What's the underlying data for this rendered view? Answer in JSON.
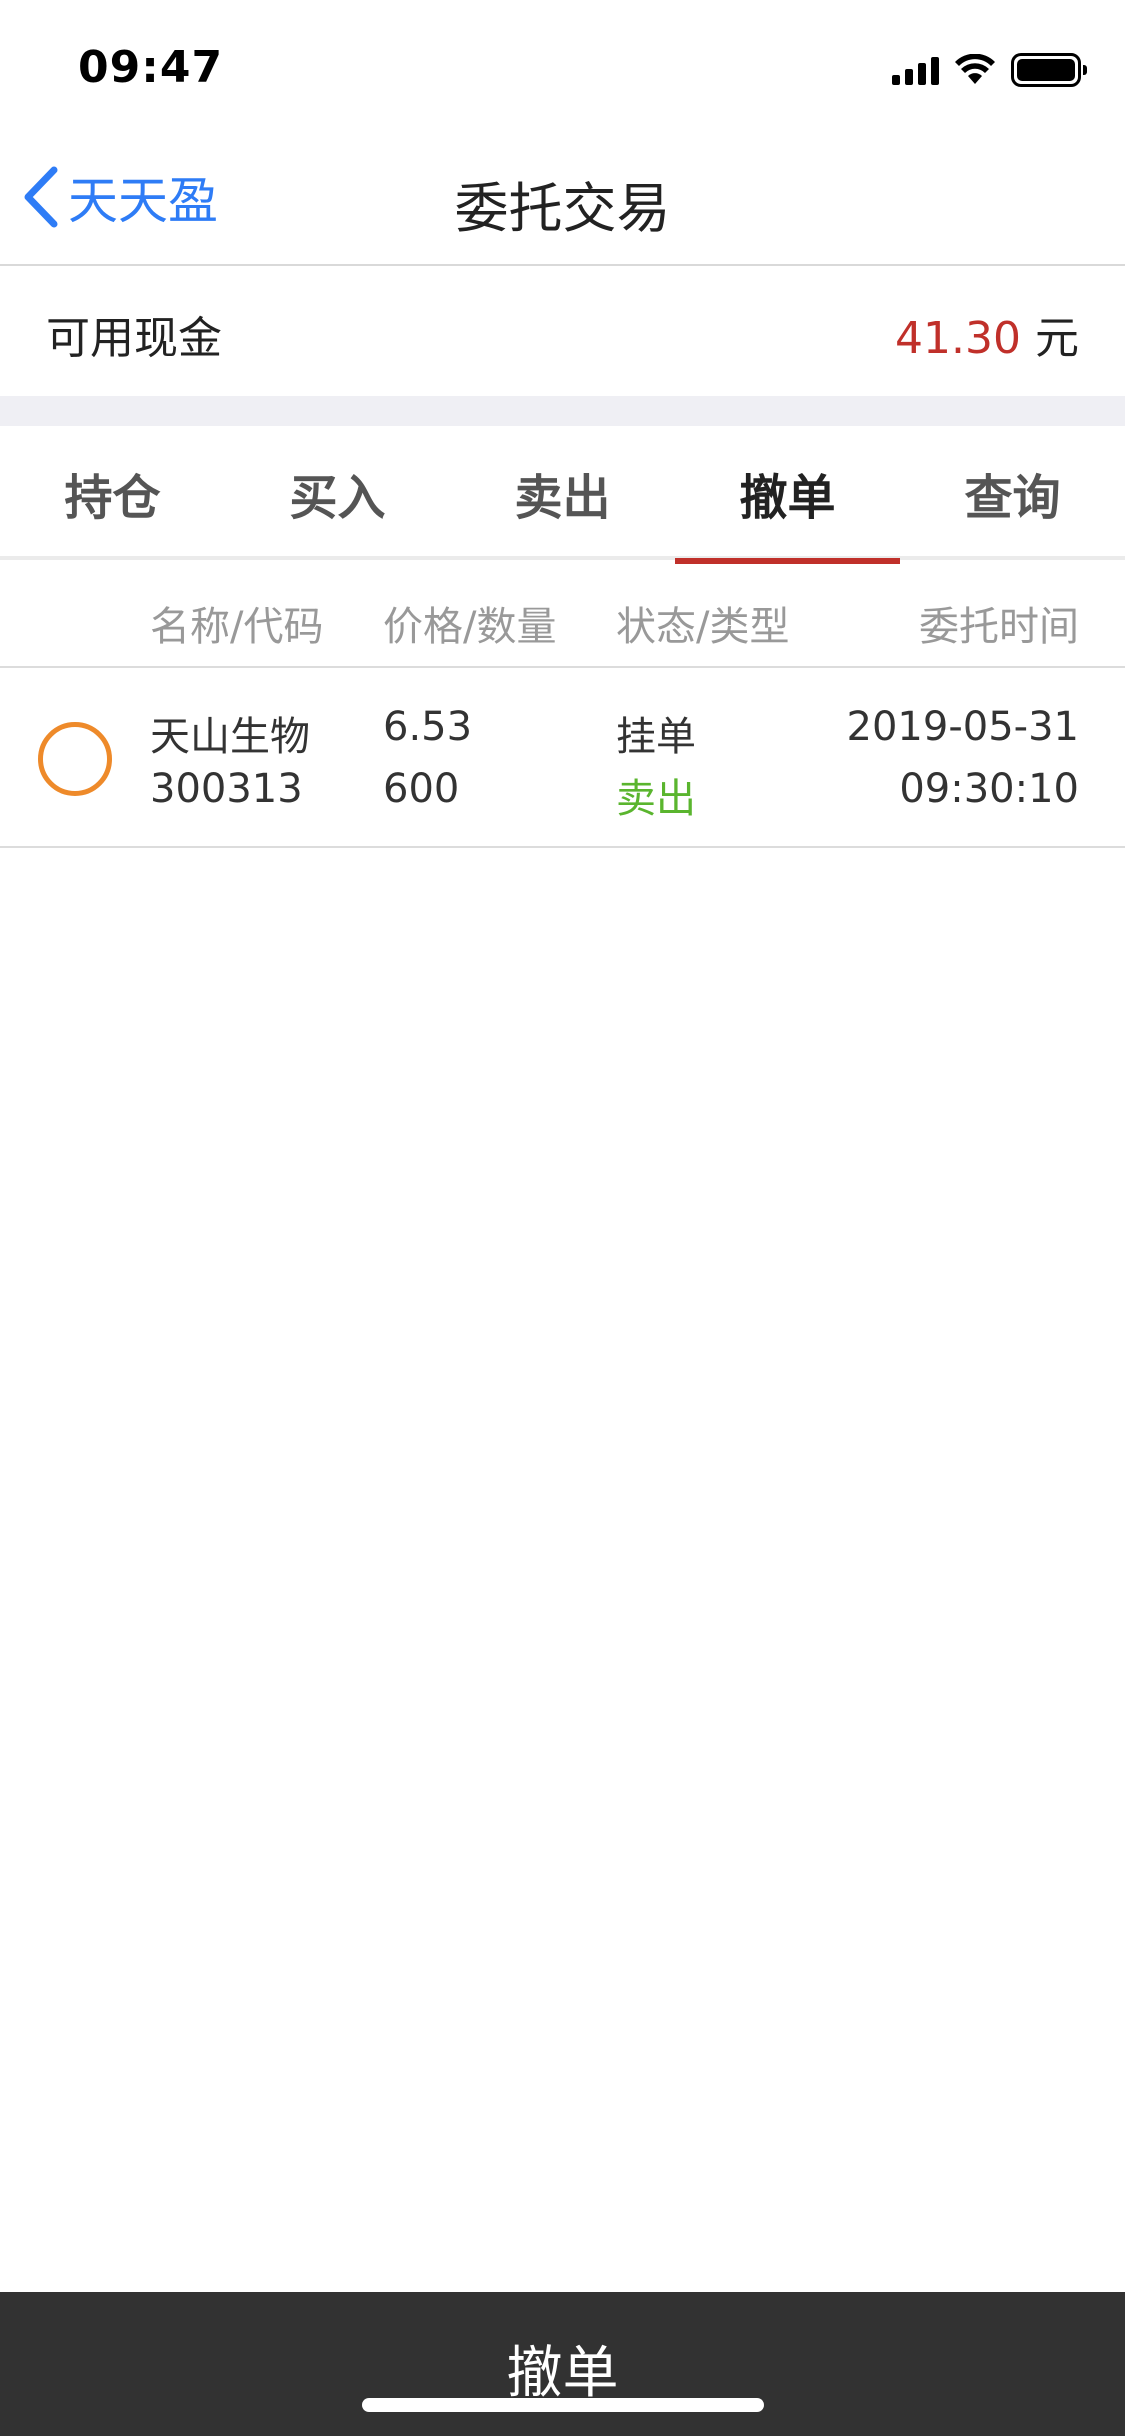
{
  "status_bar": {
    "time": "09:47"
  },
  "nav": {
    "back_label": "天天盈",
    "title": "委托交易"
  },
  "cash": {
    "label": "可用现金",
    "amount": "41.30",
    "unit": "元"
  },
  "tabs": [
    {
      "label": "持仓",
      "active": false
    },
    {
      "label": "买入",
      "active": false
    },
    {
      "label": "卖出",
      "active": false
    },
    {
      "label": "撤单",
      "active": true
    },
    {
      "label": "查询",
      "active": false
    }
  ],
  "table": {
    "headers": {
      "name_code": "名称/代码",
      "price_qty": "价格/数量",
      "status_type": "状态/类型",
      "time": "委托时间"
    },
    "rows": [
      {
        "name": "天山生物",
        "code": "300313",
        "price": "6.53",
        "quantity": "600",
        "status": "挂单",
        "type": "卖出",
        "date": "2019-05-31",
        "time": "09:30:10"
      }
    ]
  },
  "bottom": {
    "action_label": "撤单"
  },
  "colors": {
    "accent_red": "#c0302a",
    "link_blue": "#2e7cf6",
    "sell_green": "#5ab52e",
    "radio_orange": "#ee8a2a"
  }
}
